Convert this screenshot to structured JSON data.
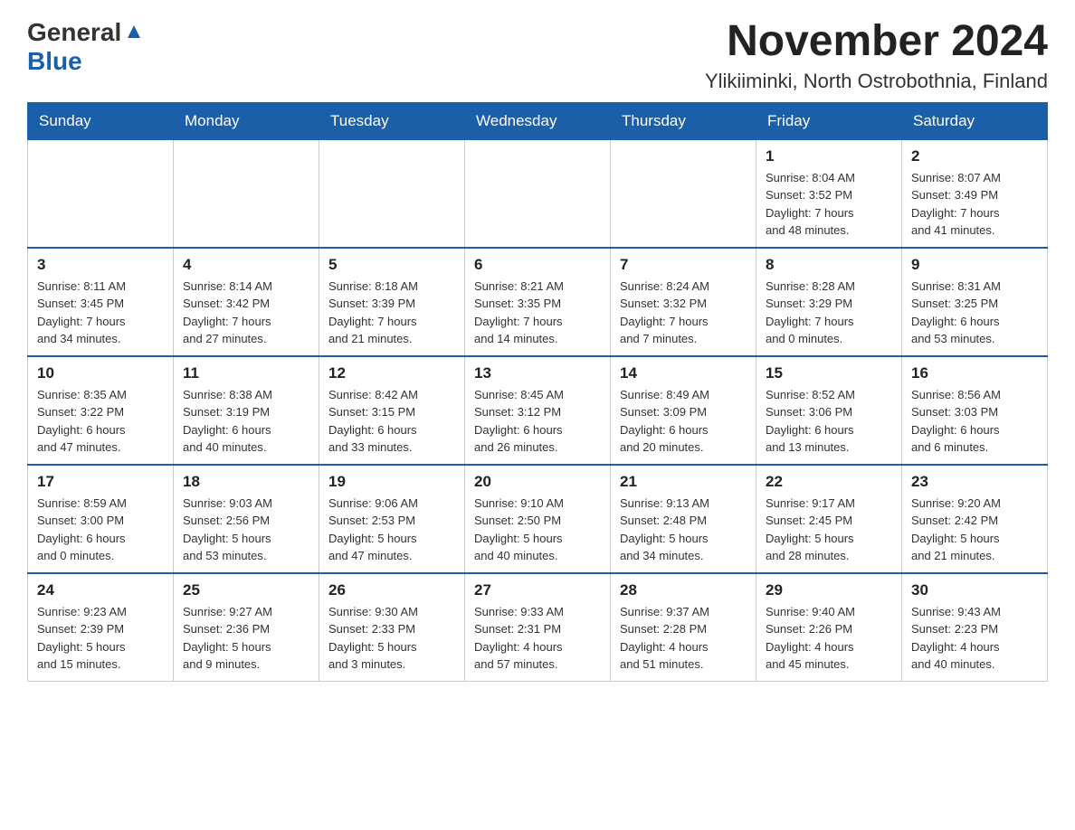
{
  "header": {
    "logo_general": "General",
    "logo_blue": "Blue",
    "title": "November 2024",
    "location": "Ylikiiminki, North Ostrobothnia, Finland"
  },
  "weekdays": [
    "Sunday",
    "Monday",
    "Tuesday",
    "Wednesday",
    "Thursday",
    "Friday",
    "Saturday"
  ],
  "weeks": [
    [
      {
        "day": "",
        "info": ""
      },
      {
        "day": "",
        "info": ""
      },
      {
        "day": "",
        "info": ""
      },
      {
        "day": "",
        "info": ""
      },
      {
        "day": "",
        "info": ""
      },
      {
        "day": "1",
        "info": "Sunrise: 8:04 AM\nSunset: 3:52 PM\nDaylight: 7 hours\nand 48 minutes."
      },
      {
        "day": "2",
        "info": "Sunrise: 8:07 AM\nSunset: 3:49 PM\nDaylight: 7 hours\nand 41 minutes."
      }
    ],
    [
      {
        "day": "3",
        "info": "Sunrise: 8:11 AM\nSunset: 3:45 PM\nDaylight: 7 hours\nand 34 minutes."
      },
      {
        "day": "4",
        "info": "Sunrise: 8:14 AM\nSunset: 3:42 PM\nDaylight: 7 hours\nand 27 minutes."
      },
      {
        "day": "5",
        "info": "Sunrise: 8:18 AM\nSunset: 3:39 PM\nDaylight: 7 hours\nand 21 minutes."
      },
      {
        "day": "6",
        "info": "Sunrise: 8:21 AM\nSunset: 3:35 PM\nDaylight: 7 hours\nand 14 minutes."
      },
      {
        "day": "7",
        "info": "Sunrise: 8:24 AM\nSunset: 3:32 PM\nDaylight: 7 hours\nand 7 minutes."
      },
      {
        "day": "8",
        "info": "Sunrise: 8:28 AM\nSunset: 3:29 PM\nDaylight: 7 hours\nand 0 minutes."
      },
      {
        "day": "9",
        "info": "Sunrise: 8:31 AM\nSunset: 3:25 PM\nDaylight: 6 hours\nand 53 minutes."
      }
    ],
    [
      {
        "day": "10",
        "info": "Sunrise: 8:35 AM\nSunset: 3:22 PM\nDaylight: 6 hours\nand 47 minutes."
      },
      {
        "day": "11",
        "info": "Sunrise: 8:38 AM\nSunset: 3:19 PM\nDaylight: 6 hours\nand 40 minutes."
      },
      {
        "day": "12",
        "info": "Sunrise: 8:42 AM\nSunset: 3:15 PM\nDaylight: 6 hours\nand 33 minutes."
      },
      {
        "day": "13",
        "info": "Sunrise: 8:45 AM\nSunset: 3:12 PM\nDaylight: 6 hours\nand 26 minutes."
      },
      {
        "day": "14",
        "info": "Sunrise: 8:49 AM\nSunset: 3:09 PM\nDaylight: 6 hours\nand 20 minutes."
      },
      {
        "day": "15",
        "info": "Sunrise: 8:52 AM\nSunset: 3:06 PM\nDaylight: 6 hours\nand 13 minutes."
      },
      {
        "day": "16",
        "info": "Sunrise: 8:56 AM\nSunset: 3:03 PM\nDaylight: 6 hours\nand 6 minutes."
      }
    ],
    [
      {
        "day": "17",
        "info": "Sunrise: 8:59 AM\nSunset: 3:00 PM\nDaylight: 6 hours\nand 0 minutes."
      },
      {
        "day": "18",
        "info": "Sunrise: 9:03 AM\nSunset: 2:56 PM\nDaylight: 5 hours\nand 53 minutes."
      },
      {
        "day": "19",
        "info": "Sunrise: 9:06 AM\nSunset: 2:53 PM\nDaylight: 5 hours\nand 47 minutes."
      },
      {
        "day": "20",
        "info": "Sunrise: 9:10 AM\nSunset: 2:50 PM\nDaylight: 5 hours\nand 40 minutes."
      },
      {
        "day": "21",
        "info": "Sunrise: 9:13 AM\nSunset: 2:48 PM\nDaylight: 5 hours\nand 34 minutes."
      },
      {
        "day": "22",
        "info": "Sunrise: 9:17 AM\nSunset: 2:45 PM\nDaylight: 5 hours\nand 28 minutes."
      },
      {
        "day": "23",
        "info": "Sunrise: 9:20 AM\nSunset: 2:42 PM\nDaylight: 5 hours\nand 21 minutes."
      }
    ],
    [
      {
        "day": "24",
        "info": "Sunrise: 9:23 AM\nSunset: 2:39 PM\nDaylight: 5 hours\nand 15 minutes."
      },
      {
        "day": "25",
        "info": "Sunrise: 9:27 AM\nSunset: 2:36 PM\nDaylight: 5 hours\nand 9 minutes."
      },
      {
        "day": "26",
        "info": "Sunrise: 9:30 AM\nSunset: 2:33 PM\nDaylight: 5 hours\nand 3 minutes."
      },
      {
        "day": "27",
        "info": "Sunrise: 9:33 AM\nSunset: 2:31 PM\nDaylight: 4 hours\nand 57 minutes."
      },
      {
        "day": "28",
        "info": "Sunrise: 9:37 AM\nSunset: 2:28 PM\nDaylight: 4 hours\nand 51 minutes."
      },
      {
        "day": "29",
        "info": "Sunrise: 9:40 AM\nSunset: 2:26 PM\nDaylight: 4 hours\nand 45 minutes."
      },
      {
        "day": "30",
        "info": "Sunrise: 9:43 AM\nSunset: 2:23 PM\nDaylight: 4 hours\nand 40 minutes."
      }
    ]
  ]
}
